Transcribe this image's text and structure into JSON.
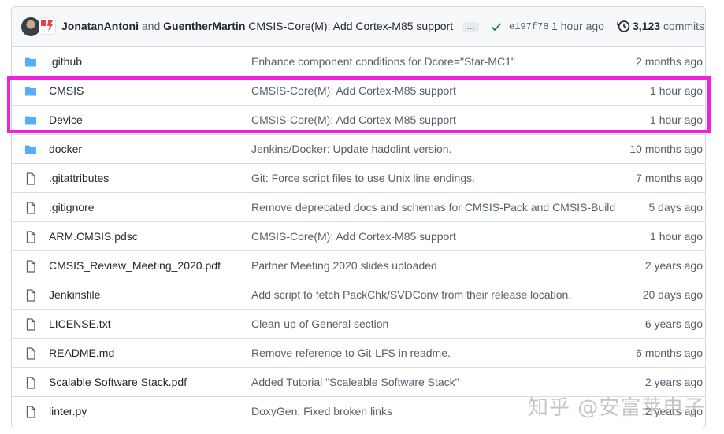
{
  "commit": {
    "author1": "JonatanAntoni",
    "and": "and",
    "author2": "GuentherMartin",
    "message": "CMSIS-Core(M): Add Cortex-M85 support",
    "ellipsis": "…",
    "sha": "e197f78",
    "time": "1 hour ago",
    "commits_count": "3,123",
    "commits_label": "commits"
  },
  "files": [
    {
      "type": "folder",
      "name": ".github",
      "message": "Enhance component conditions for Dcore=\"Star-MC1\"",
      "time": "2 months ago"
    },
    {
      "type": "folder",
      "name": "CMSIS",
      "message": "CMSIS-Core(M): Add Cortex-M85 support",
      "time": "1 hour ago"
    },
    {
      "type": "folder",
      "name": "Device",
      "message": "CMSIS-Core(M): Add Cortex-M85 support",
      "time": "1 hour ago"
    },
    {
      "type": "folder",
      "name": "docker",
      "message": "Jenkins/Docker: Update hadolint version.",
      "time": "10 months ago"
    },
    {
      "type": "file",
      "name": ".gitattributes",
      "message": "Git: Force script files to use Unix line endings.",
      "time": "7 months ago"
    },
    {
      "type": "file",
      "name": ".gitignore",
      "message": "Remove deprecated docs and schemas for CMSIS-Pack and CMSIS-Build",
      "time": "5 days ago"
    },
    {
      "type": "file",
      "name": "ARM.CMSIS.pdsc",
      "message": "CMSIS-Core(M): Add Cortex-M85 support",
      "time": "1 hour ago"
    },
    {
      "type": "file",
      "name": "CMSIS_Review_Meeting_2020.pdf",
      "message": "Partner Meeting 2020 slides uploaded",
      "time": "2 years ago"
    },
    {
      "type": "file",
      "name": "Jenkinsfile",
      "message": "Add script to fetch PackChk/SVDConv from their release location.",
      "time": "20 days ago"
    },
    {
      "type": "file",
      "name": "LICENSE.txt",
      "message": "Clean-up of General section",
      "time": "6 years ago"
    },
    {
      "type": "file",
      "name": "README.md",
      "message": "Remove reference to Git-LFS in readme.",
      "time": "6 months ago"
    },
    {
      "type": "file",
      "name": "Scalable Software Stack.pdf",
      "message": "Added Tutorial \"Scaleable Software Stack\"",
      "time": "2 years ago"
    },
    {
      "type": "file",
      "name": "linter.py",
      "message": "DoxyGen: Fixed broken links",
      "time": "2 years ago"
    }
  ],
  "watermark": "知乎 @安富莱电子",
  "colors": {
    "folder": "#54aeff",
    "highlight": "#ee22dd",
    "check": "#1a7f37"
  }
}
